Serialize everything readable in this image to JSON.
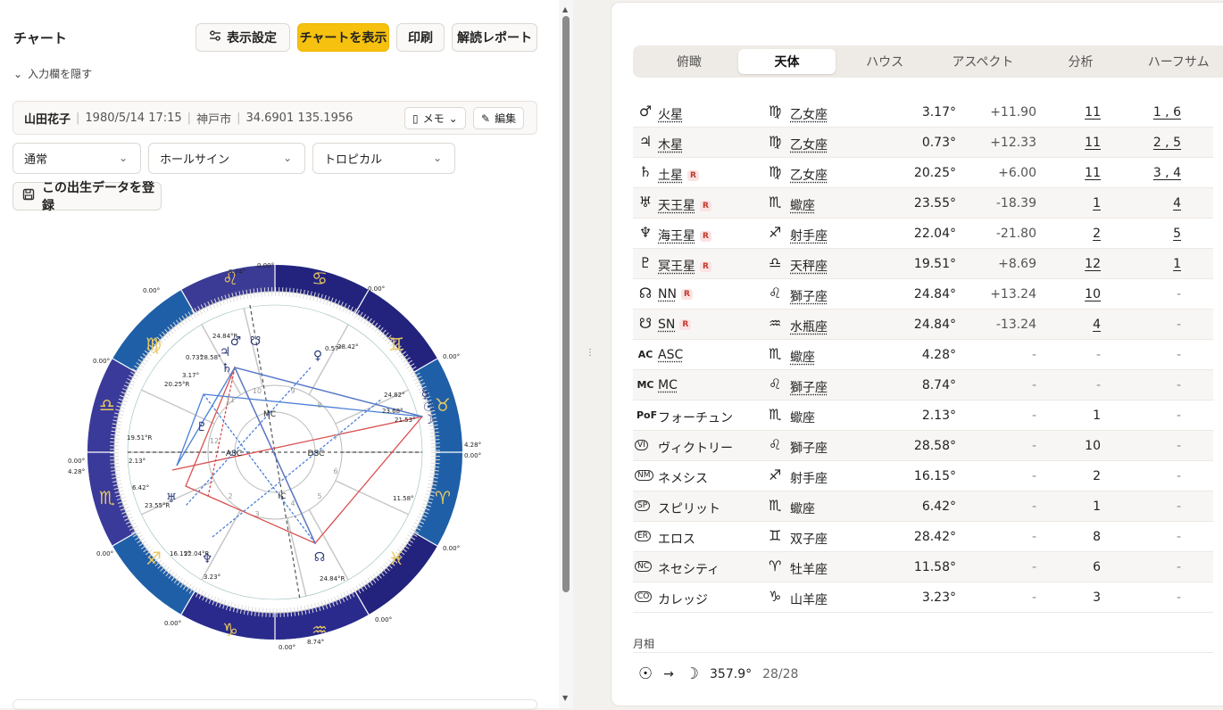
{
  "left": {
    "title": "チャート",
    "buttons": {
      "display_settings": "表示設定",
      "show_chart": "チャートを表示",
      "print": "印刷",
      "report": "解読レポート"
    },
    "hide_input": "入力欄を隠す",
    "person": {
      "name": "山田花子",
      "datetime": "1980/5/14 17:15",
      "place": "神戸市",
      "coords": "34.6901 135.1956",
      "memo": "メモ",
      "edit": "編集"
    },
    "selects": {
      "mode": "通常",
      "house": "ホールサイン",
      "zodiac": "トロピカル"
    },
    "register": "この出生データを登録"
  },
  "chart": {
    "house_labels": [
      "MC",
      "DSC",
      "IC",
      "ASC"
    ],
    "house_numbers": [
      "1",
      "2",
      "3",
      "4",
      "5",
      "6",
      "7",
      "8",
      "9",
      "10",
      "11",
      "12"
    ],
    "degree_labels": {
      "top_mc": "8.74°",
      "top_zero": "0.00°",
      "bottom_mc": "8.74°",
      "right_asc": "4.28°",
      "left_asc": "4.28°",
      "zero": "0.00°"
    },
    "planet_labels": [
      "24.84°R",
      "0.73°",
      "28.58°",
      "3.17°",
      "20.25°R",
      "0.57°",
      "28.42°",
      "24.82°",
      "23.68°",
      "21.53°",
      "19.51°R",
      "2.13°",
      "6.42°",
      "23.55°R",
      "11.58°",
      "16.15°",
      "22.04°R",
      "3.23°",
      "24.84°R"
    ]
  },
  "tabs": [
    "俯瞰",
    "天体",
    "ハウス",
    "アスペクト",
    "分析",
    "ハーフサム"
  ],
  "active_tab": "天体",
  "bodies": [
    {
      "icon": "♂",
      "name": "火星",
      "r": false,
      "link": true,
      "sicon": "♍",
      "sign": "乙女座",
      "sign_link": true,
      "deg": "3.17°",
      "asp": "+11.90",
      "house": "11",
      "house_link": true,
      "half": "1 , 6",
      "half_link": true
    },
    {
      "icon": "♃",
      "name": "木星",
      "r": false,
      "link": true,
      "sicon": "♍",
      "sign": "乙女座",
      "sign_link": true,
      "deg": "0.73°",
      "asp": "+12.33",
      "house": "11",
      "house_link": true,
      "half": "2 , 5",
      "half_link": true
    },
    {
      "icon": "♄",
      "name": "土星",
      "r": true,
      "link": true,
      "sicon": "♍",
      "sign": "乙女座",
      "sign_link": true,
      "deg": "20.25°",
      "asp": "+6.00",
      "house": "11",
      "house_link": true,
      "half": "3 , 4",
      "half_link": true
    },
    {
      "icon": "♅",
      "name": "天王星",
      "r": true,
      "link": true,
      "sicon": "♏",
      "sign": "蠍座",
      "sign_link": true,
      "deg": "23.55°",
      "asp": "-18.39",
      "house": "1",
      "house_link": true,
      "half": "4",
      "half_link": true
    },
    {
      "icon": "♆",
      "name": "海王星",
      "r": true,
      "link": true,
      "sicon": "♐",
      "sign": "射手座",
      "sign_link": true,
      "deg": "22.04°",
      "asp": "-21.80",
      "house": "2",
      "house_link": true,
      "half": "5",
      "half_link": true
    },
    {
      "icon": "♇",
      "name": "冥王星",
      "r": true,
      "link": true,
      "sicon": "♎",
      "sign": "天秤座",
      "sign_link": true,
      "deg": "19.51°",
      "asp": "+8.69",
      "house": "12",
      "house_link": true,
      "half": "1",
      "half_link": true
    },
    {
      "icon": "☊",
      "name": "NN",
      "r": true,
      "link": true,
      "sicon": "♌",
      "sign": "獅子座",
      "sign_link": true,
      "deg": "24.84°",
      "asp": "+13.24",
      "house": "10",
      "house_link": true,
      "half": "-",
      "half_link": false
    },
    {
      "icon": "☋",
      "name": "SN",
      "r": true,
      "link": true,
      "sicon": "♒",
      "sign": "水瓶座",
      "sign_link": true,
      "deg": "24.84°",
      "asp": "-13.24",
      "house": "4",
      "house_link": true,
      "half": "-",
      "half_link": false
    },
    {
      "icon": "AC",
      "icontype": "txt",
      "name": "ASC",
      "r": false,
      "link": true,
      "sicon": "♏",
      "sign": "蠍座",
      "sign_link": true,
      "deg": "4.28°",
      "asp": "-",
      "house": "-",
      "house_link": false,
      "half": "-",
      "half_link": false
    },
    {
      "icon": "MC",
      "icontype": "txt",
      "name": "MC",
      "r": false,
      "link": true,
      "sicon": "♌",
      "sign": "獅子座",
      "sign_link": true,
      "deg": "8.74°",
      "asp": "-",
      "house": "-",
      "house_link": false,
      "half": "-",
      "half_link": false
    },
    {
      "icon": "PoF",
      "icontype": "txt",
      "name": "フォーチュン",
      "r": false,
      "link": false,
      "sicon": "♏",
      "sign": "蠍座",
      "sign_link": false,
      "deg": "2.13°",
      "asp": "-",
      "house": "1",
      "house_link": false,
      "half": "-",
      "half_link": false
    },
    {
      "icon": "VI",
      "icontype": "circ",
      "name": "ヴィクトリー",
      "r": false,
      "link": false,
      "sicon": "♌",
      "sign": "獅子座",
      "sign_link": false,
      "deg": "28.58°",
      "asp": "-",
      "house": "10",
      "house_link": false,
      "half": "-",
      "half_link": false
    },
    {
      "icon": "NM",
      "icontype": "circ",
      "name": "ネメシス",
      "r": false,
      "link": false,
      "sicon": "♐",
      "sign": "射手座",
      "sign_link": false,
      "deg": "16.15°",
      "asp": "-",
      "house": "2",
      "house_link": false,
      "half": "-",
      "half_link": false
    },
    {
      "icon": "SP",
      "icontype": "circ",
      "name": "スピリット",
      "r": false,
      "link": false,
      "sicon": "♏",
      "sign": "蠍座",
      "sign_link": false,
      "deg": "6.42°",
      "asp": "-",
      "house": "1",
      "house_link": false,
      "half": "-",
      "half_link": false
    },
    {
      "icon": "ER",
      "icontype": "circ",
      "name": "エロス",
      "r": false,
      "link": false,
      "sicon": "♊",
      "sign": "双子座",
      "sign_link": false,
      "deg": "28.42°",
      "asp": "-",
      "house": "8",
      "house_link": false,
      "half": "-",
      "half_link": false
    },
    {
      "icon": "NC",
      "icontype": "circ",
      "name": "ネセシティ",
      "r": false,
      "link": false,
      "sicon": "♈",
      "sign": "牡羊座",
      "sign_link": false,
      "deg": "11.58°",
      "asp": "-",
      "house": "6",
      "house_link": false,
      "half": "-",
      "half_link": false
    },
    {
      "icon": "CO",
      "icontype": "circ",
      "name": "カレッジ",
      "r": false,
      "link": false,
      "sicon": "♑",
      "sign": "山羊座",
      "sign_link": false,
      "deg": "3.23°",
      "asp": "-",
      "house": "3",
      "house_link": false,
      "half": "-",
      "half_link": false
    }
  ],
  "r_badge": "R",
  "moon_phase": {
    "label": "月相",
    "sun_icon": "☉",
    "arrow": "→",
    "moon_icon": "☽",
    "angle": "357.9°",
    "day": "28/28"
  },
  "colors": {
    "accent": "#f6c10f",
    "zodiac_dark": "#23237e",
    "zodiac_blue": "#1f5fa8",
    "aspect_red": "#d95050",
    "aspect_blue": "#4a7fd6"
  }
}
